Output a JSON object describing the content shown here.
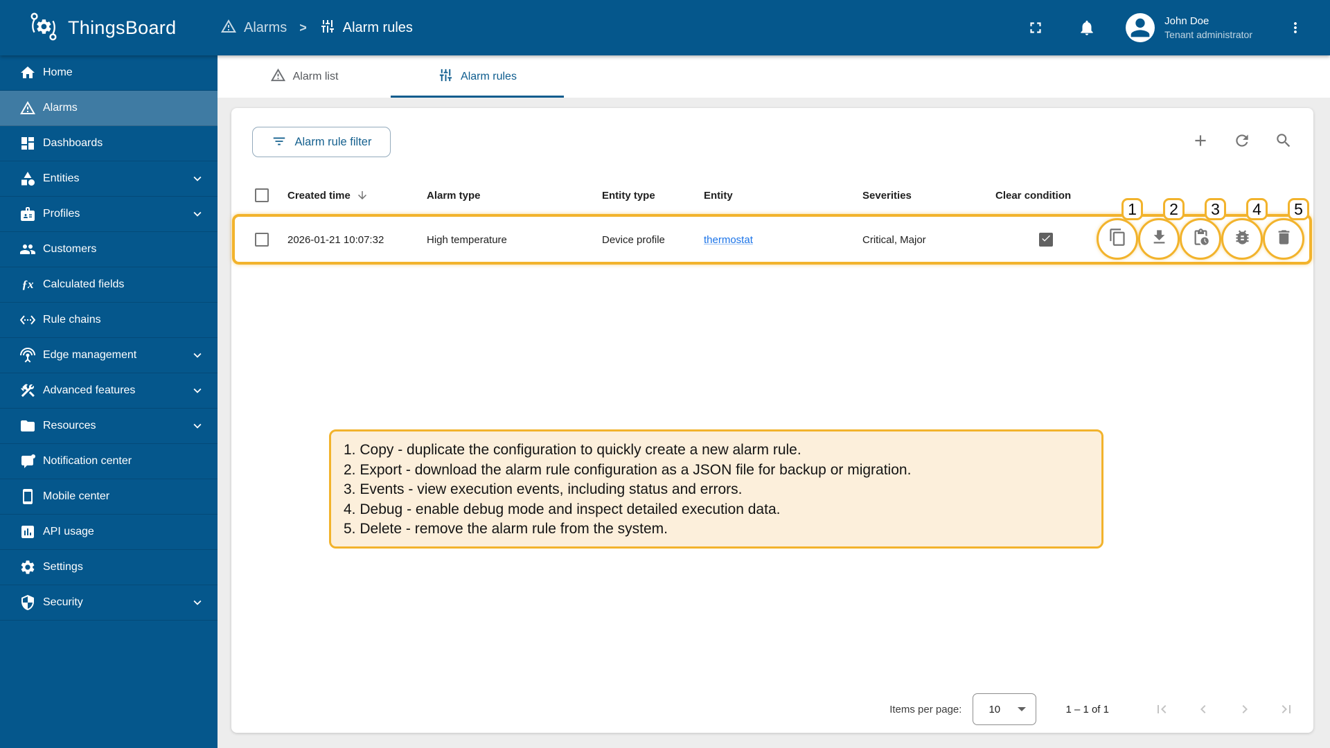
{
  "header": {
    "logo_text": "ThingsBoard",
    "breadcrumb": {
      "parent": "Alarms",
      "separator": ">",
      "current": "Alarm rules"
    },
    "user": {
      "name": "John Doe",
      "role": "Tenant administrator"
    }
  },
  "sidebar": {
    "items": [
      {
        "label": "Home",
        "icon": "home-icon",
        "active": false,
        "expandable": false
      },
      {
        "label": "Alarms",
        "icon": "warning-icon",
        "active": true,
        "expandable": false
      },
      {
        "label": "Dashboards",
        "icon": "dashboard-icon",
        "active": false,
        "expandable": false
      },
      {
        "label": "Entities",
        "icon": "category-icon",
        "active": false,
        "expandable": true
      },
      {
        "label": "Profiles",
        "icon": "badge-icon",
        "active": false,
        "expandable": true
      },
      {
        "label": "Customers",
        "icon": "people-icon",
        "active": false,
        "expandable": false
      },
      {
        "label": "Calculated fields",
        "icon": "function-icon",
        "active": false,
        "expandable": false
      },
      {
        "label": "Rule chains",
        "icon": "ethernet-icon",
        "active": false,
        "expandable": false
      },
      {
        "label": "Edge management",
        "icon": "antenna-icon",
        "active": false,
        "expandable": true
      },
      {
        "label": "Advanced features",
        "icon": "tools-icon",
        "active": false,
        "expandable": true
      },
      {
        "label": "Resources",
        "icon": "folder-icon",
        "active": false,
        "expandable": true
      },
      {
        "label": "Notification center",
        "icon": "notification-bubble-icon",
        "active": false,
        "expandable": false
      },
      {
        "label": "Mobile center",
        "icon": "smartphone-icon",
        "active": false,
        "expandable": false
      },
      {
        "label": "API usage",
        "icon": "chart-icon",
        "active": false,
        "expandable": false
      },
      {
        "label": "Settings",
        "icon": "gear-icon",
        "active": false,
        "expandable": false
      },
      {
        "label": "Security",
        "icon": "shield-icon",
        "active": false,
        "expandable": true
      }
    ]
  },
  "tabs": [
    {
      "label": "Alarm list",
      "active": false
    },
    {
      "label": "Alarm rules",
      "active": true
    }
  ],
  "toolbar": {
    "filter_button_label": "Alarm rule filter"
  },
  "table": {
    "columns": [
      "Created time",
      "Alarm type",
      "Entity type",
      "Entity",
      "Severities",
      "Clear condition"
    ],
    "rows": [
      {
        "created_time": "2026-01-21 10:07:32",
        "alarm_type": "High temperature",
        "entity_type": "Device profile",
        "entity": "thermostat",
        "severities": "Critical, Major",
        "clear_condition": true
      }
    ]
  },
  "actions": [
    {
      "number": "1",
      "name": "Copy"
    },
    {
      "number": "2",
      "name": "Export"
    },
    {
      "number": "3",
      "name": "Events"
    },
    {
      "number": "4",
      "name": "Debug"
    },
    {
      "number": "5",
      "name": "Delete"
    }
  ],
  "annotation": {
    "lines": [
      "1. Copy - duplicate the configuration to quickly create a new alarm rule.",
      "2. Export -  download the alarm rule configuration as a JSON file for backup or migration.",
      "3. Events - view execution events, including status and errors.",
      "4. Debug - enable debug mode and inspect detailed execution data.",
      "5. Delete - remove the alarm rule from the system."
    ]
  },
  "pagination": {
    "items_per_page_label": "Items per page:",
    "items_per_page_value": "10",
    "range_label": "1 – 1 of 1"
  },
  "colors": {
    "primary_blue": "#05578c",
    "sidebar_active": "#3f7ba3",
    "tab_active": "#0d5c8e",
    "annotation_yellow": "#f2b32c",
    "annotation_bg": "#fcefdb",
    "link_blue": "#1a73e8",
    "icon_gray": "#757575"
  }
}
